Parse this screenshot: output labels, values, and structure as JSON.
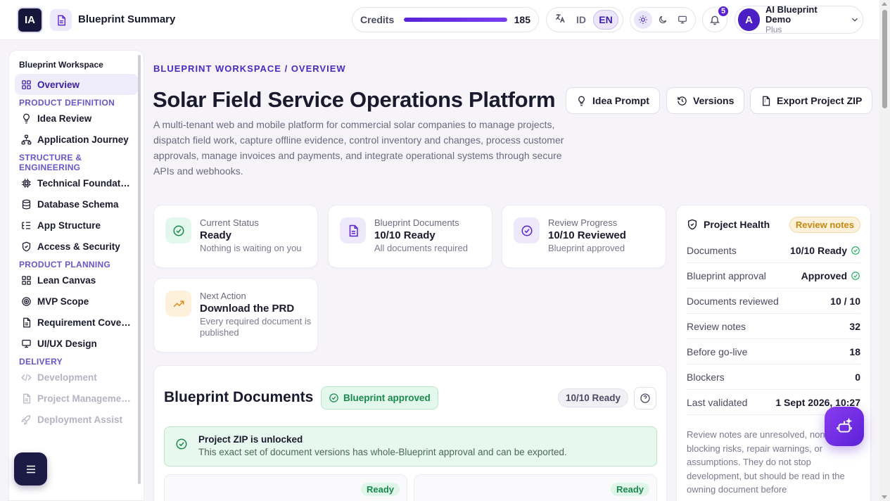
{
  "header": {
    "logo": "IA",
    "title": "Blueprint Summary",
    "credits": {
      "label": "Credits",
      "value": "185",
      "fill_percent": 100
    },
    "language": {
      "id_label": "ID",
      "en_label": "EN",
      "selected": "EN"
    },
    "theme_selected": "light",
    "notifications": {
      "count": "5"
    },
    "user": {
      "avatar": "A",
      "name": "AI Blueprint Demo",
      "plan": "Plus"
    }
  },
  "sidebar": {
    "workspace": "Blueprint Workspace",
    "items": [
      {
        "type": "item",
        "label": "Overview",
        "icon": "grid-icon",
        "active": true
      },
      {
        "type": "section",
        "label": "PRODUCT DEFINITION"
      },
      {
        "type": "item",
        "label": "Idea Review",
        "icon": "lightbulb-icon"
      },
      {
        "type": "item",
        "label": "Application Journey",
        "icon": "sitemap-icon"
      },
      {
        "type": "section",
        "label": "STRUCTURE & ENGINEERING"
      },
      {
        "type": "item",
        "label": "Technical Foundati…",
        "icon": "chip-icon"
      },
      {
        "type": "item",
        "label": "Database Schema",
        "icon": "database-icon"
      },
      {
        "type": "item",
        "label": "App Structure",
        "icon": "list-tree-icon"
      },
      {
        "type": "item",
        "label": "Access & Security",
        "icon": "shield-icon"
      },
      {
        "type": "section",
        "label": "PRODUCT PLANNING"
      },
      {
        "type": "item",
        "label": "Lean Canvas",
        "icon": "grid-icon"
      },
      {
        "type": "item",
        "label": "MVP Scope",
        "icon": "target-icon"
      },
      {
        "type": "item",
        "label": "Requirement Cover…",
        "icon": "document-icon"
      },
      {
        "type": "item",
        "label": "UI/UX Design",
        "icon": "monitor-icon"
      },
      {
        "type": "section",
        "label": "DELIVERY"
      },
      {
        "type": "item",
        "label": "Development",
        "icon": "code-icon",
        "disabled": true
      },
      {
        "type": "item",
        "label": "Project Manageme…",
        "icon": "document-icon",
        "disabled": true
      },
      {
        "type": "item",
        "label": "Deployment Assist",
        "icon": "rocket-icon",
        "disabled": true
      }
    ]
  },
  "main": {
    "breadcrumb": "BLUEPRINT WORKSPACE / OVERVIEW",
    "title": "Solar Field Service Operations Platform",
    "description": "A multi-tenant web and mobile platform for commercial solar companies to manage projects, dispatch field work, capture offline evidence, control inventory and changes, process customer approvals, manage invoices and payments, and integrate operational systems through secure APIs and webhooks.",
    "actions": {
      "idea_prompt": "Idea Prompt",
      "versions": "Versions",
      "export": "Export Project ZIP"
    },
    "stats": [
      {
        "label": "Current Status",
        "value": "Ready",
        "sub": "Nothing is waiting on you",
        "icon": "check-circle-icon"
      },
      {
        "label": "Blueprint Documents",
        "value": "10/10 Ready",
        "sub": "All documents required",
        "icon": "document-icon"
      },
      {
        "label": "Review Progress",
        "value": "10/10 Reviewed",
        "sub": "Blueprint approved",
        "icon": "check-circle-icon"
      },
      {
        "label": "Next Action",
        "value": "Download the PRD",
        "sub": "Every required document is published",
        "icon": "trend-up-icon"
      }
    ],
    "health": {
      "title": "Project Health",
      "badge": "Review notes",
      "rows": [
        {
          "label": "Documents",
          "value": "10/10 Ready",
          "check": true
        },
        {
          "label": "Blueprint approval",
          "value": "Approved",
          "check": true
        },
        {
          "label": "Documents reviewed",
          "value": "10 / 10"
        },
        {
          "label": "Review notes",
          "value": "32"
        },
        {
          "label": "Before go-live",
          "value": "18"
        },
        {
          "label": "Blockers",
          "value": "0"
        },
        {
          "label": "Last validated",
          "value": "1 Sept 2026, 10:27"
        }
      ],
      "note": "Review notes are unresolved, non-blocking risks, repair warnings, or assumptions. They do not stop development, but should be read in the owning document before"
    },
    "documents": {
      "title": "Blueprint Documents",
      "approved": "Blueprint approved",
      "ready_count": "10/10 Ready",
      "zip_title": "Project ZIP is unlocked",
      "zip_sub": "This exact set of document versions has whole-Blueprint approval and can be exported.",
      "cards": [
        {
          "status": "Ready"
        },
        {
          "status": "Ready"
        }
      ]
    }
  },
  "colors": {
    "accent": "#5b21d6",
    "success": "#178a4c",
    "warning": "#c8880f"
  }
}
